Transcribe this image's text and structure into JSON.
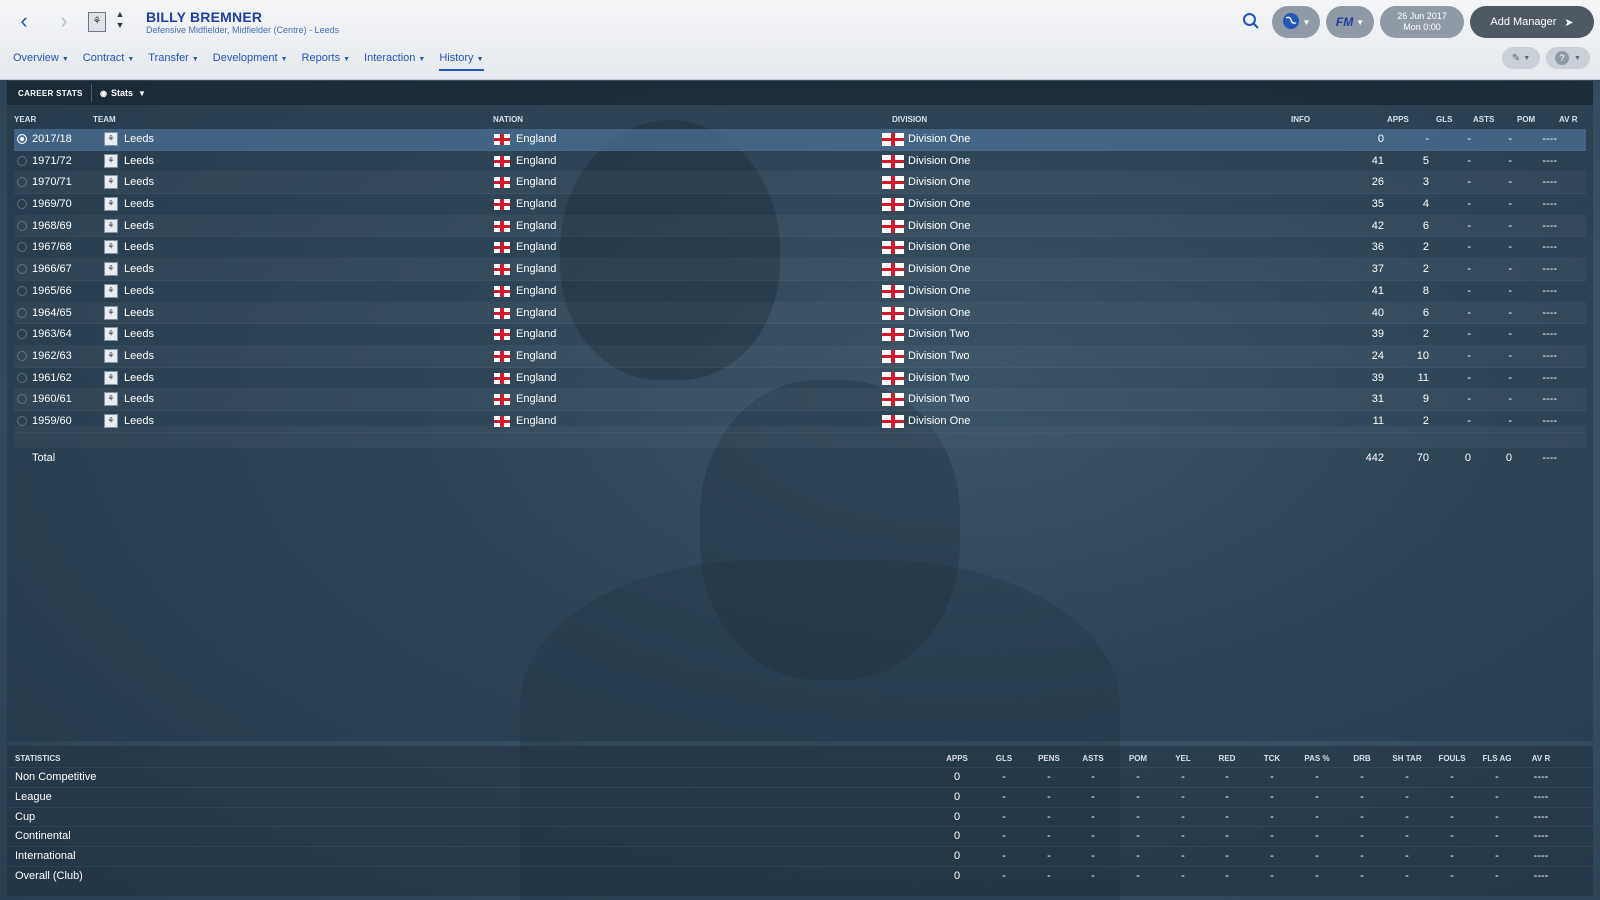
{
  "header": {
    "player_name": "BILLY BREMNER",
    "player_subtitle": "Defensive Midfielder, Midfielder (Centre) - Leeds",
    "date_line1": "26 Jun 2017",
    "date_line2": "Mon 0:00",
    "add_manager_label": "Add Manager",
    "fm_label": "FM"
  },
  "menu": [
    {
      "label": "Overview"
    },
    {
      "label": "Contract"
    },
    {
      "label": "Transfer"
    },
    {
      "label": "Development"
    },
    {
      "label": "Reports"
    },
    {
      "label": "Interaction"
    },
    {
      "label": "History"
    }
  ],
  "active_menu": "History",
  "career": {
    "title": "CAREER STATS",
    "view_label": "Stats",
    "columns": {
      "year": "YEAR",
      "team": "TEAM",
      "nation": "NATION",
      "division": "DIVISION",
      "info": "INFO",
      "apps": "APPS",
      "gls": "GLS",
      "asts": "ASTS",
      "pom": "POM",
      "avr": "AV R"
    },
    "rows": [
      {
        "year": "2017/18",
        "team": "Leeds",
        "nation": "England",
        "division": "Division One",
        "apps": "0",
        "gls": "-",
        "asts": "-",
        "pom": "-",
        "avr": "----"
      },
      {
        "year": "1971/72",
        "team": "Leeds",
        "nation": "England",
        "division": "Division One",
        "apps": "41",
        "gls": "5",
        "asts": "-",
        "pom": "-",
        "avr": "----"
      },
      {
        "year": "1970/71",
        "team": "Leeds",
        "nation": "England",
        "division": "Division One",
        "apps": "26",
        "gls": "3",
        "asts": "-",
        "pom": "-",
        "avr": "----"
      },
      {
        "year": "1969/70",
        "team": "Leeds",
        "nation": "England",
        "division": "Division One",
        "apps": "35",
        "gls": "4",
        "asts": "-",
        "pom": "-",
        "avr": "----"
      },
      {
        "year": "1968/69",
        "team": "Leeds",
        "nation": "England",
        "division": "Division One",
        "apps": "42",
        "gls": "6",
        "asts": "-",
        "pom": "-",
        "avr": "----"
      },
      {
        "year": "1967/68",
        "team": "Leeds",
        "nation": "England",
        "division": "Division One",
        "apps": "36",
        "gls": "2",
        "asts": "-",
        "pom": "-",
        "avr": "----"
      },
      {
        "year": "1966/67",
        "team": "Leeds",
        "nation": "England",
        "division": "Division One",
        "apps": "37",
        "gls": "2",
        "asts": "-",
        "pom": "-",
        "avr": "----"
      },
      {
        "year": "1965/66",
        "team": "Leeds",
        "nation": "England",
        "division": "Division One",
        "apps": "41",
        "gls": "8",
        "asts": "-",
        "pom": "-",
        "avr": "----"
      },
      {
        "year": "1964/65",
        "team": "Leeds",
        "nation": "England",
        "division": "Division One",
        "apps": "40",
        "gls": "6",
        "asts": "-",
        "pom": "-",
        "avr": "----"
      },
      {
        "year": "1963/64",
        "team": "Leeds",
        "nation": "England",
        "division": "Division Two",
        "apps": "39",
        "gls": "2",
        "asts": "-",
        "pom": "-",
        "avr": "----"
      },
      {
        "year": "1962/63",
        "team": "Leeds",
        "nation": "England",
        "division": "Division Two",
        "apps": "24",
        "gls": "10",
        "asts": "-",
        "pom": "-",
        "avr": "----"
      },
      {
        "year": "1961/62",
        "team": "Leeds",
        "nation": "England",
        "division": "Division Two",
        "apps": "39",
        "gls": "11",
        "asts": "-",
        "pom": "-",
        "avr": "----"
      },
      {
        "year": "1960/61",
        "team": "Leeds",
        "nation": "England",
        "division": "Division Two",
        "apps": "31",
        "gls": "9",
        "asts": "-",
        "pom": "-",
        "avr": "----"
      },
      {
        "year": "1959/60",
        "team": "Leeds",
        "nation": "England",
        "division": "Division One",
        "apps": "11",
        "gls": "2",
        "asts": "-",
        "pom": "-",
        "avr": "----"
      }
    ],
    "total": {
      "label": "Total",
      "apps": "442",
      "gls": "70",
      "asts": "0",
      "pom": "0",
      "avr": "----"
    }
  },
  "statistics": {
    "title": "STATISTICS",
    "columns": [
      "APPS",
      "GLS",
      "PENS",
      "ASTS",
      "POM",
      "YEL",
      "RED",
      "TCK",
      "PAS %",
      "DRB",
      "SH TAR",
      "FOULS",
      "FLS AG",
      "AV R"
    ],
    "rows": [
      {
        "label": "Non Competitive",
        "values": [
          "0",
          "-",
          "-",
          "-",
          "-",
          "-",
          "-",
          "-",
          "-",
          "-",
          "-",
          "-",
          "-",
          "----"
        ]
      },
      {
        "label": "League",
        "values": [
          "0",
          "-",
          "-",
          "-",
          "-",
          "-",
          "-",
          "-",
          "-",
          "-",
          "-",
          "-",
          "-",
          "----"
        ]
      },
      {
        "label": "Cup",
        "values": [
          "0",
          "-",
          "-",
          "-",
          "-",
          "-",
          "-",
          "-",
          "-",
          "-",
          "-",
          "-",
          "-",
          "----"
        ]
      },
      {
        "label": "Continental",
        "values": [
          "0",
          "-",
          "-",
          "-",
          "-",
          "-",
          "-",
          "-",
          "-",
          "-",
          "-",
          "-",
          "-",
          "----"
        ]
      },
      {
        "label": "International",
        "values": [
          "0",
          "-",
          "-",
          "-",
          "-",
          "-",
          "-",
          "-",
          "-",
          "-",
          "-",
          "-",
          "-",
          "----"
        ]
      },
      {
        "label": "Overall (Club)",
        "values": [
          "0",
          "-",
          "-",
          "-",
          "-",
          "-",
          "-",
          "-",
          "-",
          "-",
          "-",
          "-",
          "-",
          "----"
        ]
      }
    ]
  },
  "colors": {
    "accent": "#2456b8",
    "selected_row": "#4a6f96",
    "header_bg": "#eef0f3"
  },
  "icons": {
    "back": "chevron-left-icon",
    "forward": "chevron-right-icon",
    "search": "search-icon",
    "globe": "globe-icon",
    "help": "help-icon",
    "edit": "pencil-icon",
    "flag": "england-flag-icon",
    "team": "leeds-badge-icon"
  }
}
